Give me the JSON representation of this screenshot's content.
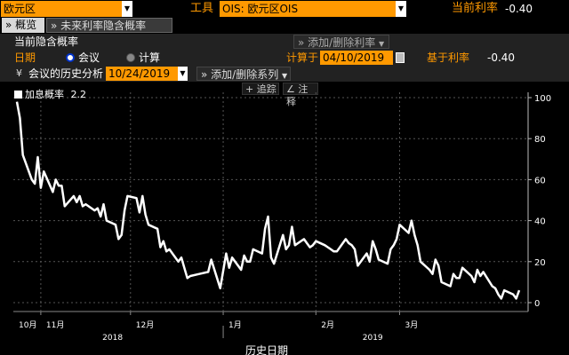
{
  "header": {
    "region_value": "欧元区",
    "tool_label": "工具",
    "tool_value": "OIS: 欧元区OIS",
    "current_rate_label": "当前利率",
    "current_rate_value": "-0.40"
  },
  "tabs": [
    {
      "label": "概览",
      "icon": "play-icon"
    },
    {
      "label": "未来利率隐含概率",
      "icon": "play-icon"
    }
  ],
  "panel": {
    "title": "当前隐含概率",
    "add_remove_rate": "添加/删除利率",
    "date_label": "日期",
    "option_meeting": "会议",
    "option_calc": "计算",
    "calc_on_label": "计算于",
    "calc_on_date": "04/10/2019",
    "base_rate_label": "基于利率",
    "base_rate_value": "-0.40",
    "history_label": "会议的历史分析",
    "history_date": "10/24/2019",
    "add_remove_series": "添加/删除系列"
  },
  "chart_toolbar": {
    "track": "追踪",
    "annotate": "注释"
  },
  "colors": {
    "accent": "#ff9900",
    "line": "#ffffff",
    "background": "#000000"
  },
  "chart_data": {
    "type": "line",
    "title": "",
    "xlabel": "历史日期",
    "ylabel": "",
    "ylim": [
      0,
      100
    ],
    "yticks": [
      0,
      20,
      40,
      60,
      80,
      100
    ],
    "grid": true,
    "legend_position": "top-left",
    "x_month_labels": [
      "10月",
      "11月",
      "12月",
      "1月",
      "2月",
      "3月"
    ],
    "x_year_labels": [
      "2018",
      "2019"
    ],
    "series": [
      {
        "name": "加息概率",
        "last_value": "2.2",
        "color": "#ffffff",
        "x": [
          "2018-10-24",
          "2018-10-25",
          "2018-10-26",
          "2018-10-29",
          "2018-10-30",
          "2018-10-31",
          "2018-11-01",
          "2018-11-02",
          "2018-11-05",
          "2018-11-06",
          "2018-11-07",
          "2018-11-08",
          "2018-11-09",
          "2018-11-12",
          "2018-11-13",
          "2018-11-14",
          "2018-11-15",
          "2018-11-16",
          "2018-11-19",
          "2018-11-20",
          "2018-11-21",
          "2018-11-22",
          "2018-11-23",
          "2018-11-26",
          "2018-11-27",
          "2018-11-28",
          "2018-11-29",
          "2018-11-30",
          "2018-12-03",
          "2018-12-04",
          "2018-12-05",
          "2018-12-06",
          "2018-12-07",
          "2018-12-10",
          "2018-12-11",
          "2018-12-12",
          "2018-12-13",
          "2018-12-14",
          "2018-12-17",
          "2018-12-18",
          "2018-12-19",
          "2018-12-20",
          "2018-12-21",
          "2018-12-24",
          "2018-12-27",
          "2018-12-28",
          "2018-12-31",
          "2019-01-02",
          "2019-01-03",
          "2019-01-04",
          "2019-01-07",
          "2019-01-08",
          "2019-01-09",
          "2019-01-10",
          "2019-01-11",
          "2019-01-14",
          "2019-01-15",
          "2019-01-16",
          "2019-01-17",
          "2019-01-18",
          "2019-01-21",
          "2019-01-22",
          "2019-01-23",
          "2019-01-24",
          "2019-01-25",
          "2019-01-28",
          "2019-01-29",
          "2019-01-30",
          "2019-01-31",
          "2019-02-01",
          "2019-02-04",
          "2019-02-05",
          "2019-02-06",
          "2019-02-07",
          "2019-02-08",
          "2019-02-11",
          "2019-02-12",
          "2019-02-13",
          "2019-02-14",
          "2019-02-15",
          "2019-02-18",
          "2019-02-19",
          "2019-02-20",
          "2019-02-21",
          "2019-02-22",
          "2019-02-25",
          "2019-02-26",
          "2019-02-27",
          "2019-02-28",
          "2019-03-01",
          "2019-03-04",
          "2019-03-05",
          "2019-03-06",
          "2019-03-07",
          "2019-03-08",
          "2019-03-11",
          "2019-03-12",
          "2019-03-13",
          "2019-03-14",
          "2019-03-15",
          "2019-03-18",
          "2019-03-19",
          "2019-03-20",
          "2019-03-21",
          "2019-03-22",
          "2019-03-25",
          "2019-03-26",
          "2019-03-27",
          "2019-03-28",
          "2019-03-29",
          "2019-04-01",
          "2019-04-02",
          "2019-04-03",
          "2019-04-04",
          "2019-04-05",
          "2019-04-08",
          "2019-04-09",
          "2019-04-10"
        ],
        "values": [
          98,
          90,
          72,
          60,
          58,
          71,
          56,
          64,
          54,
          60,
          57,
          57,
          47,
          52,
          49,
          52,
          47,
          48,
          45,
          46,
          42,
          48,
          40,
          38,
          31,
          33,
          45,
          52,
          51,
          44,
          52,
          43,
          38,
          36,
          27,
          30,
          25,
          26,
          20,
          22,
          17,
          12,
          13,
          14,
          15,
          21,
          7,
          24,
          17,
          22,
          16,
          23,
          20,
          20,
          26,
          24,
          36,
          42,
          22,
          19,
          33,
          26,
          28,
          37,
          28,
          31,
          29,
          27,
          28,
          30,
          28,
          27,
          26,
          25,
          25,
          31,
          29,
          28,
          26,
          18,
          24,
          20,
          30,
          26,
          21,
          19,
          26,
          28,
          31,
          38,
          34,
          40,
          33,
          28,
          20,
          16,
          14,
          21,
          18,
          10,
          8,
          14,
          12,
          12,
          17,
          13,
          10,
          16,
          13,
          15,
          8,
          7,
          4,
          2,
          6,
          4,
          2,
          6
        ]
      }
    ]
  }
}
